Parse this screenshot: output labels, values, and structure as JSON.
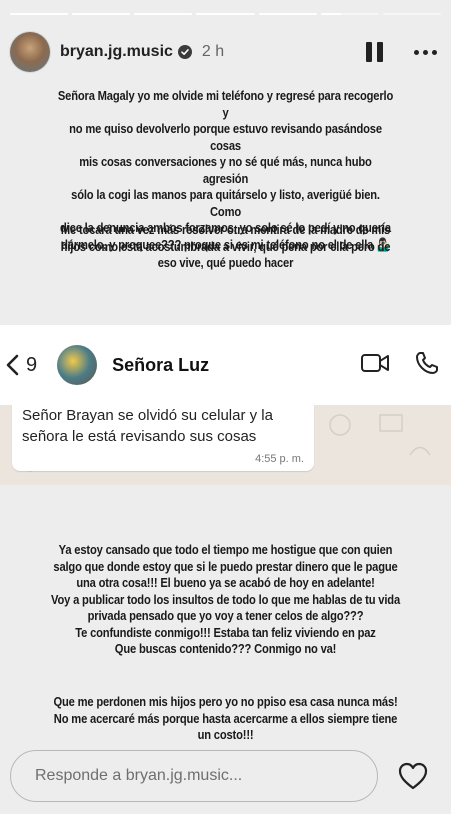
{
  "story": {
    "progress": [
      1,
      1,
      1,
      1,
      1,
      0.35,
      0
    ],
    "username": "bryan.jg.music",
    "time": "2 h",
    "verified": true,
    "icons": {
      "pause": "pause-icon",
      "more": "more-icon",
      "verified": "verified-badge-icon"
    }
  },
  "text1": [
    "Señora Magaly yo me olvide mi teléfono y regresé para recogerlo y",
    "no me quiso devolverlo porque estuvo revisando pasándose cosas",
    "mis cosas conversaciones y no sé qué más, nunca hubo agresión",
    "sólo la cogi las manos para quitárselo y listo, averigüé bien.  Como",
    "dice la denuncia ambos forzamos, yo solo sé lo pedí y no quería",
    "dármelo, y proquee??? proque si es mi teléfono no el de ella 🤷🏻‍♂️"
  ],
  "text2": [
    "Me tocará una vez más resolver otra mentira de la madre de mis",
    "hijos como  esta acostumbrada a vivir, qué pena por ella pero de",
    "eso vive, qué puedo hacer"
  ],
  "chat": {
    "back_count": "9",
    "contact_name": "Señora Luz",
    "message": "Señor Brayan se olvidó su celular y la señora le está revisando sus cosas",
    "message_time": "4:55 p. m.",
    "icons": {
      "back": "chevron-left-icon",
      "video": "video-call-icon",
      "phone": "phone-call-icon"
    }
  },
  "text3": [
    "Ya estoy cansado que todo el tiempo me hostigue que con quien",
    "salgo que donde estoy que si le puedo prestar dinero que le pague",
    "una otra cosa!!!  El bueno ya se acabó de hoy en adelante!",
    "Voy a publicar todo los insultos de todo lo que me hablas de tu vida",
    "privada pensado que yo voy a tener celos de algo???",
    "Te confundiste conmigo!!!  Estaba tan feliz viviendo en paz",
    "Que buscas contenido??? Conmigo no va!"
  ],
  "text4": [
    "Que me perdonen mis hijos pero yo no ppiso esa casa nunca más!",
    "No me acercaré más porque hasta acercarme a ellos siempre tiene",
    "un costo!!!"
  ],
  "reply": {
    "placeholder": "Responde a bryan.jg.music...",
    "icon": "heart-icon"
  }
}
